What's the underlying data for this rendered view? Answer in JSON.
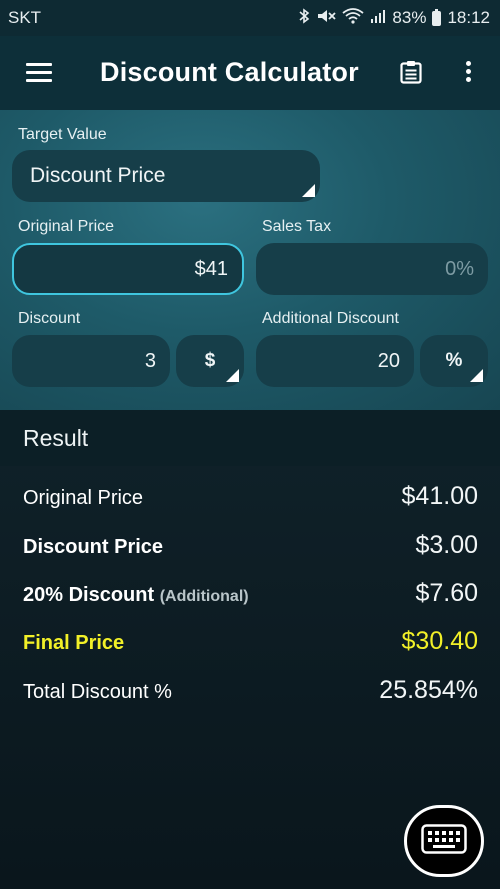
{
  "status_bar": {
    "carrier": "SKT",
    "battery": "83%",
    "time": "18:12",
    "icons": [
      "bluetooth-icon",
      "mute-icon",
      "wifi-icon",
      "signal-icon",
      "battery-icon"
    ]
  },
  "app_bar": {
    "title": "Discount Calculator",
    "icons": [
      "menu-icon",
      "clipboard-icon",
      "more-vert-icon"
    ]
  },
  "form": {
    "target_label": "Target Value",
    "target_value": "Discount Price",
    "original_price_label": "Original Price",
    "original_price_value": "$41",
    "sales_tax_label": "Sales Tax",
    "sales_tax_placeholder": "0%",
    "discount_label": "Discount",
    "discount_value": "3",
    "discount_unit": "$",
    "additional_discount_label": "Additional Discount",
    "additional_discount_value": "20",
    "additional_discount_unit": "%"
  },
  "result": {
    "header": "Result",
    "rows": [
      {
        "label": "Original Price",
        "value": "$41.00"
      },
      {
        "label": "Discount Price",
        "value": "$3.00"
      },
      {
        "label": "20% Discount",
        "sub": "(Additional)",
        "value": "$7.60"
      },
      {
        "label": "Final Price",
        "value": "$30.40"
      },
      {
        "label": "Total Discount %",
        "value": "25.854%"
      }
    ]
  },
  "colors": {
    "accent_focus": "#3fc6df",
    "final_price": "#f2f028",
    "panel": "#1e5a68",
    "app_bar": "#0d2f39"
  }
}
